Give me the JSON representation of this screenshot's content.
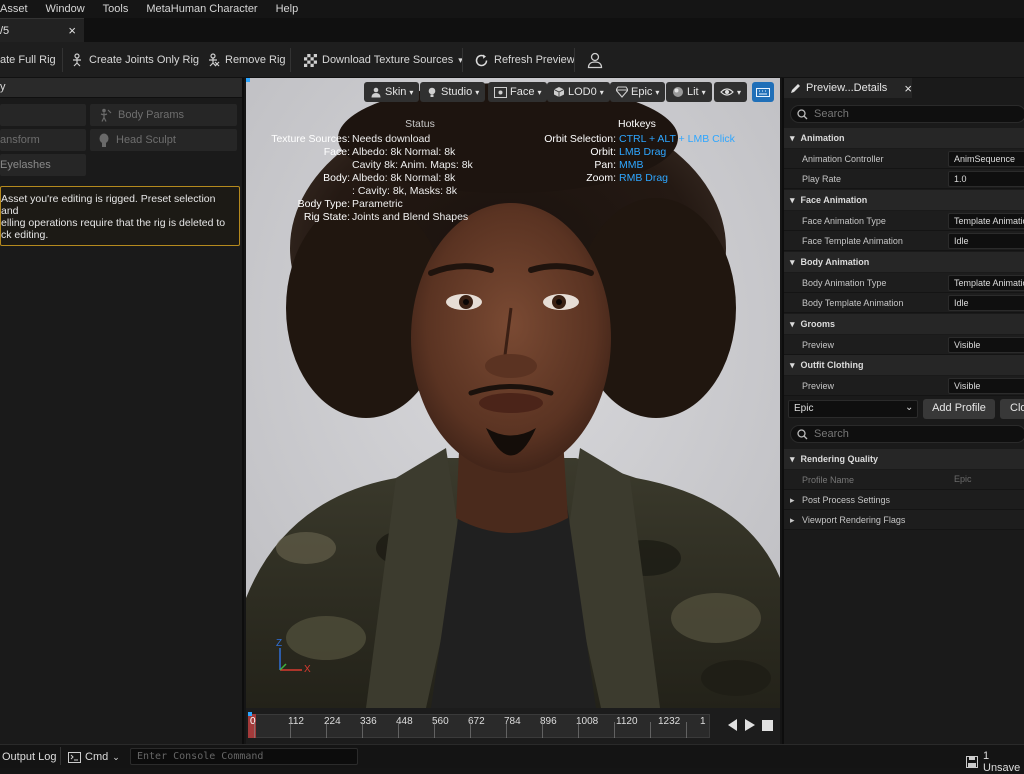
{
  "menu": {
    "items": [
      "Asset",
      "Window",
      "Tools",
      "MetaHuman Character",
      "Help"
    ]
  },
  "tab": {
    "title": "/5",
    "close": "×"
  },
  "toolbar": {
    "create_full_rig": "ate Full Rig",
    "create_joints_only_rig": "Create Joints Only Rig",
    "remove_rig": "Remove Rig",
    "download_texture_sources": "Download Texture Sources",
    "download_dropdown": "▾",
    "refresh_preview": "Refresh Preview"
  },
  "left_panel": {
    "header": "y",
    "buttons": {
      "body_params": "Body Params",
      "transform": "ansform",
      "head_sculpt": "Head Sculpt",
      "eyelashes": "Eyelashes"
    },
    "warning_lines": [
      "Asset you're editing is rigged. Preset selection and",
      "elling operations require that the rig is deleted to",
      "ck editing."
    ]
  },
  "viewport": {
    "toolbar": {
      "skin": "Skin",
      "studio": "Studio",
      "face": "Face",
      "lod": "LOD0",
      "quality": "Epic",
      "lit": "Lit"
    },
    "status": {
      "title": "Status",
      "texture_sources_label": "Texture Sources:",
      "texture_sources_value": "Needs download",
      "face_label": "Face:",
      "face_value1": "Albedo: 8k Normal: 8k",
      "face_value2": "Cavity 8k: Anim. Maps: 8k",
      "body_label": "Body:",
      "body_value1": "Albedo: 8k Normal: 8k",
      "body_value2": ": Cavity: 8k, Masks: 8k",
      "body_type_label": "Body Type:",
      "body_type_value": "Parametric",
      "rig_state_label": "Rig State:",
      "rig_state_value": "Joints and Blend Shapes"
    },
    "hotkeys": {
      "title": "Hotkeys",
      "orbit_selection_label": "Orbit Selection:",
      "orbit_selection_value": "CTRL + ALT + LMB Click",
      "orbit_label": "Orbit:",
      "orbit_value": "LMB Drag",
      "pan_label": "Pan:",
      "pan_value": "MMB",
      "zoom_label": "Zoom:",
      "zoom_value": "RMB Drag"
    },
    "axis": {
      "z": "Z",
      "x": "X"
    }
  },
  "timeline": {
    "frames": [
      "0",
      "112",
      "224",
      "336",
      "448",
      "560",
      "672",
      "784",
      "896",
      "1008",
      "1120",
      "1232",
      "1"
    ]
  },
  "details": {
    "tab_title": "Preview...Details",
    "tab_close": "×",
    "search_placeholder": "Search",
    "sections": {
      "animation": "Animation",
      "face_animation": "Face Animation",
      "body_animation": "Body Animation",
      "grooms": "Grooms",
      "outfit_clothing": "Outfit Clothing"
    },
    "props": {
      "animation_controller": {
        "label": "Animation Controller",
        "value": "AnimSequence"
      },
      "play_rate": {
        "label": "Play Rate",
        "value": "1.0"
      },
      "face_animation_type": {
        "label": "Face Animation Type",
        "value": "Template Animation"
      },
      "face_template_animation": {
        "label": "Face Template Animation",
        "value": "Idle"
      },
      "body_animation_type": {
        "label": "Body Animation Type",
        "value": "Template Animation"
      },
      "body_template_animation": {
        "label": "Body Template Animation",
        "value": "Idle"
      },
      "grooms_preview": {
        "label": "Preview",
        "value": "Visible"
      },
      "outfit_preview": {
        "label": "Preview",
        "value": "Visible"
      }
    },
    "profile": {
      "select_value": "Epic",
      "add_profile": "Add Profile",
      "clone": "Clo"
    },
    "search2_placeholder": "Search",
    "rendering": {
      "title": "Rendering Quality",
      "profile_name_label": "Profile Name",
      "profile_name_value": "Epic",
      "post_process": "Post Process Settings",
      "viewport_flags": "Viewport Rendering Flags"
    }
  },
  "statusbar": {
    "output_log": "Output Log",
    "cmd": "Cmd",
    "console_placeholder": "Enter Console Command",
    "unsaved": "1 Unsave"
  },
  "colors": {
    "accent_blue": "#2ea6ff",
    "warning_border": "#b58a1e",
    "panel_bg": "#1a1a1a"
  }
}
